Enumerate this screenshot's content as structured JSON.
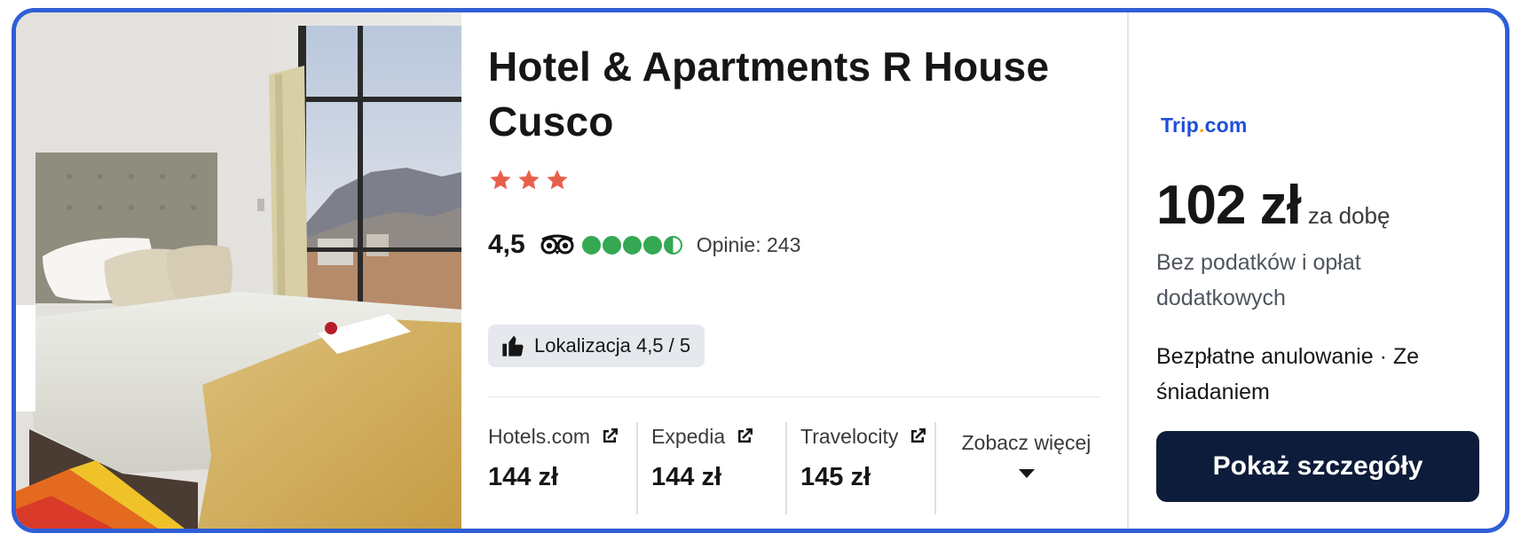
{
  "hotel": {
    "name": "Hotel & Apartments R House Cusco",
    "star_count": 3,
    "rating_value": "4,5",
    "bubble_rating": 4.5,
    "reviews_label": "Opinie: 243",
    "location_badge": "Lokalizacja 4,5 / 5"
  },
  "providers": [
    {
      "name": "Hotels.com",
      "price": "144 zł"
    },
    {
      "name": "Expedia",
      "price": "144 zł"
    },
    {
      "name": "Travelocity",
      "price": "145 zł"
    }
  ],
  "see_more_label": "Zobacz więcej",
  "offer": {
    "logo_main": "Trip",
    "logo_dot": ".",
    "logo_tld": "com",
    "price": "102 zł",
    "per_night": "za dobę",
    "tax_note": "Bez podatków i opłat dodatkowych",
    "perks": "Bezpłatne anulowanie · Ze śniadaniem",
    "cta_label": "Pokaż szczegóły"
  },
  "colors": {
    "border_accent": "#2f5fd6",
    "star": "#e8604a",
    "bubble": "#34a853",
    "cta_bg": "#0d1c3a",
    "logo_blue": "#1f4fd8",
    "logo_dot": "#f4a516"
  },
  "icons": [
    "star-icon",
    "tripadvisor-owl-icon",
    "thumbs-up-icon",
    "external-link-icon",
    "chevron-down-icon"
  ]
}
